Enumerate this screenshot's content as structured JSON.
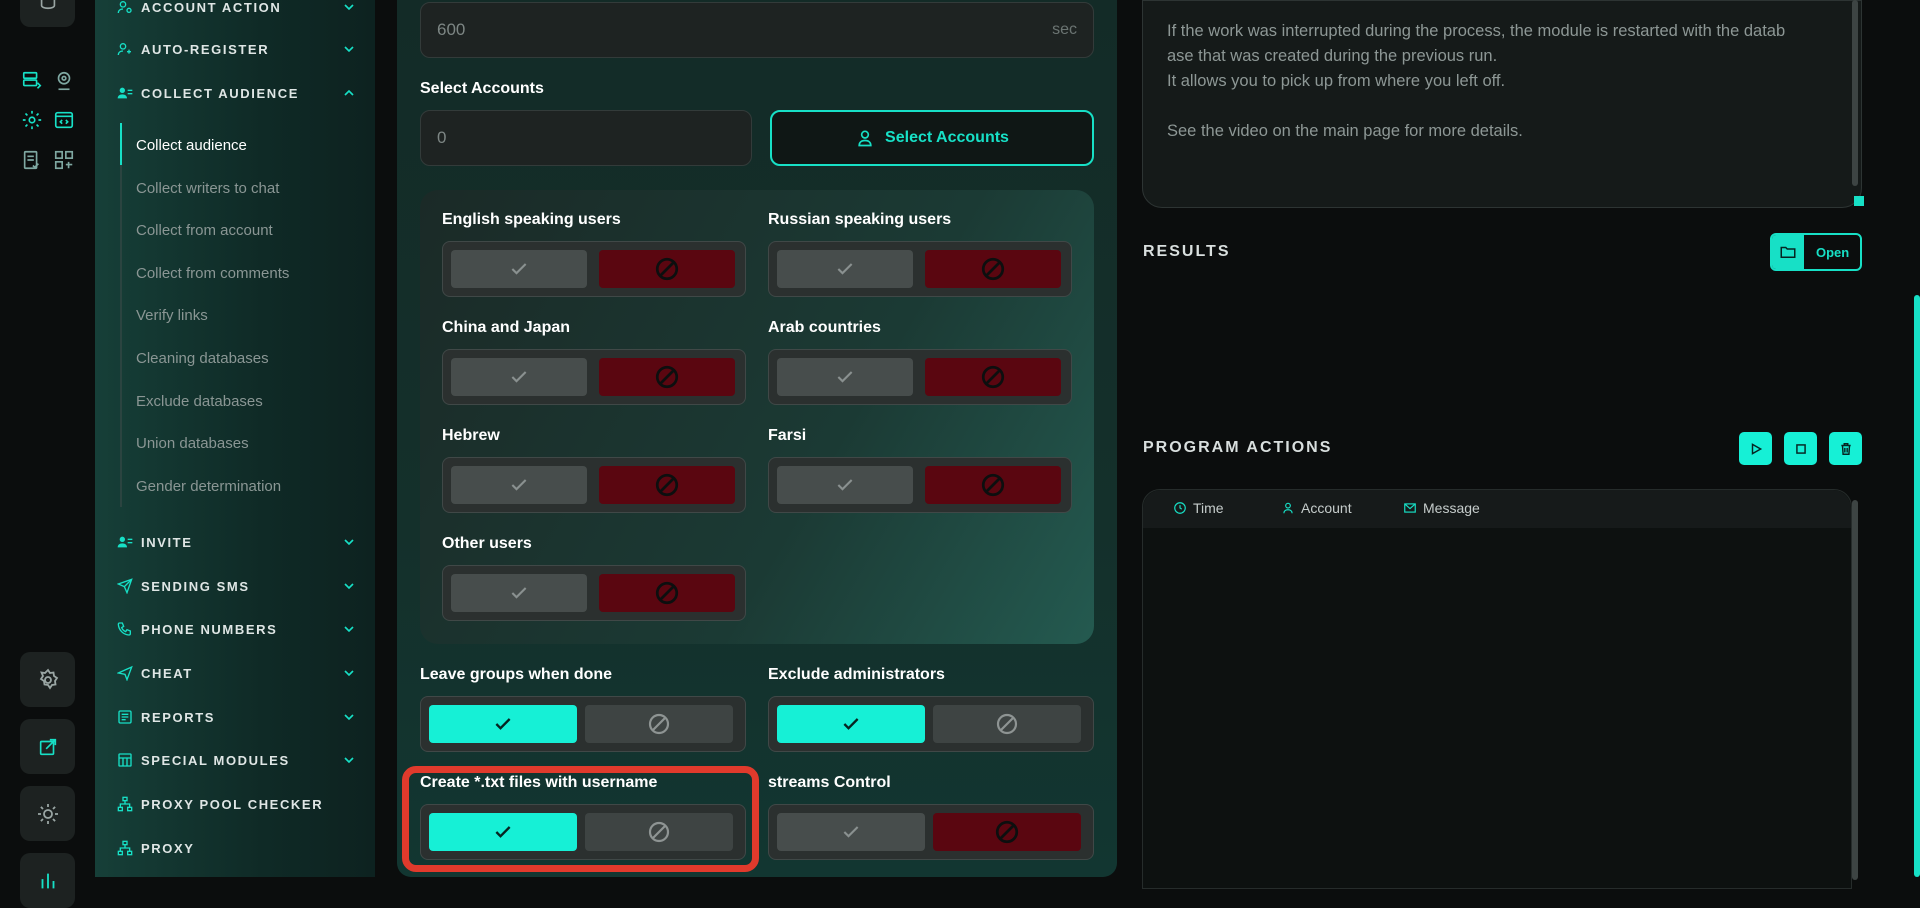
{
  "rail": {
    "icons": [
      "database-icon",
      "database-list-icon",
      "webcam-icon",
      "settings-gear-icon",
      "code-window-icon",
      "checklist-icon",
      "apps-icon"
    ],
    "bottom": [
      "settings-icon",
      "external-link-icon",
      "brightness-icon",
      "chart-icon"
    ]
  },
  "sidebar": {
    "sections": [
      {
        "label": "ACCOUNT ACTION",
        "icon": "user-gear-icon"
      },
      {
        "label": "AUTO-REGISTER",
        "icon": "user-plus-icon"
      },
      {
        "label": "COLLECT AUDIENCE",
        "icon": "users-list-icon"
      },
      {
        "label": "INVITE",
        "icon": "users-list-icon"
      },
      {
        "label": "SENDING SMS",
        "icon": "paper-plane-icon"
      },
      {
        "label": "PHONE NUMBERS",
        "icon": "phone-icon"
      },
      {
        "label": "CHEAT",
        "icon": "send-icon"
      },
      {
        "label": "REPORTS",
        "icon": "report-icon"
      },
      {
        "label": "SPECIAL MODULES",
        "icon": "grid-module-icon"
      },
      {
        "label": "PROXY POOL CHECKER",
        "icon": "network-icon"
      },
      {
        "label": "PROXY",
        "icon": "network-icon"
      }
    ],
    "sub_items": [
      "Collect audience",
      "Collect writers to chat",
      "Collect from account",
      "Collect from comments",
      "Verify links",
      "Cleaning databases",
      "Exclude databases",
      "Union databases",
      "Gender determination"
    ]
  },
  "form": {
    "delay_value": "600",
    "delay_unit": "sec",
    "select_accounts_label": "Select Accounts",
    "accounts_count": "0",
    "select_accounts_button": "Select Accounts",
    "languages": [
      {
        "label": "English speaking users",
        "enabled": false
      },
      {
        "label": "Russian speaking users",
        "enabled": false
      },
      {
        "label": "China and Japan",
        "enabled": false
      },
      {
        "label": "Arab countries",
        "enabled": false
      },
      {
        "label": "Hebrew",
        "enabled": false
      },
      {
        "label": "Farsi",
        "enabled": false
      },
      {
        "label": "Other users",
        "enabled": false
      }
    ],
    "leave_groups_label": "Leave groups when done",
    "exclude_admins_label": "Exclude administrators",
    "create_txt_label": "Create *.txt files with username",
    "streams_label": "streams Control",
    "leave_groups_on": true,
    "exclude_admins_on": true,
    "create_txt_on": true,
    "streams_on": false
  },
  "info": {
    "line1": "If the work was interrupted during the process, the module is restarted with the datab",
    "line2": "ase that was created during the previous run.",
    "line3": "It allows you to pick up from where you left off.",
    "line4": "See the video on the main page for more details."
  },
  "results": {
    "title": "RESULTS",
    "open_label": "Open"
  },
  "program_actions": {
    "title": "PROGRAM ACTIONS",
    "columns": [
      "Time",
      "Account",
      "Message"
    ]
  },
  "colors": {
    "accent": "#17e0c6",
    "deny": "#5a0610",
    "highlight": "#e03a2c"
  }
}
